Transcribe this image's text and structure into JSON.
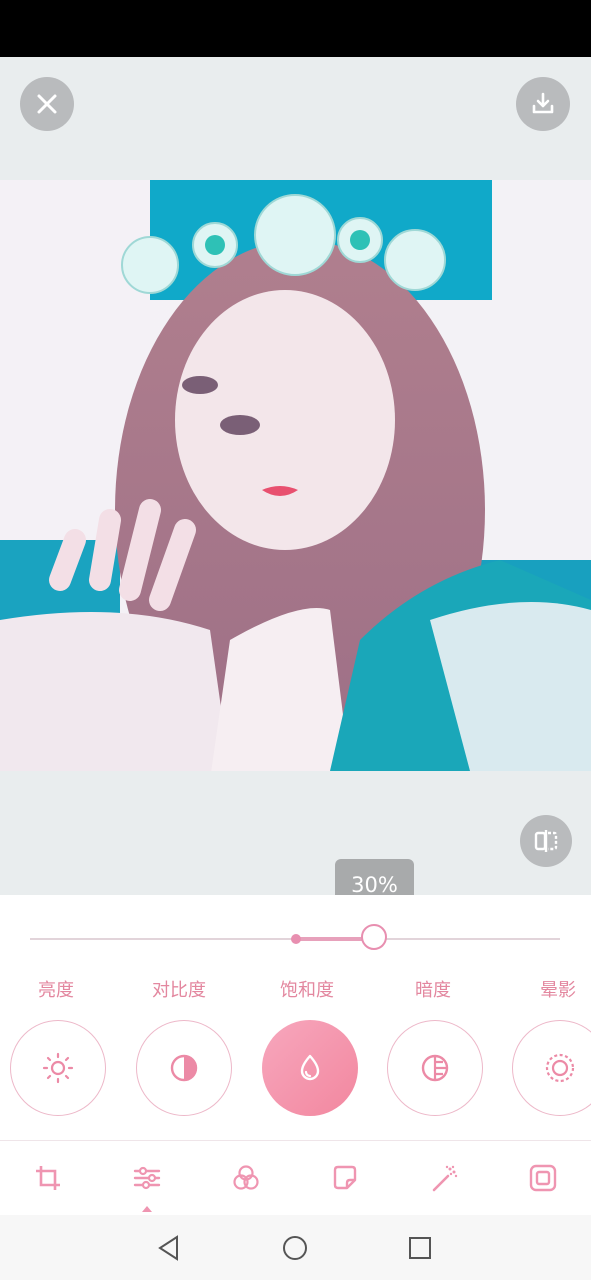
{
  "slider": {
    "value_label": "30%",
    "value": 0.3
  },
  "tools": [
    {
      "label": "亮度",
      "icon": "brightness-icon",
      "active": false
    },
    {
      "label": "对比度",
      "icon": "contrast-icon",
      "active": false
    },
    {
      "label": "饱和度",
      "icon": "saturation-drop-icon",
      "active": true
    },
    {
      "label": "暗度",
      "icon": "shadow-icon",
      "active": false
    },
    {
      "label": "晕影",
      "icon": "vignette-icon",
      "active": false
    }
  ],
  "bottom_tabs": [
    {
      "icon": "crop-icon",
      "active": false
    },
    {
      "icon": "adjust-sliders-icon",
      "active": true
    },
    {
      "icon": "filters-circles-icon",
      "active": false
    },
    {
      "icon": "sticker-icon",
      "active": false
    },
    {
      "icon": "magic-wand-icon",
      "active": false
    },
    {
      "icon": "frame-icon",
      "active": false
    }
  ],
  "colors": {
    "accent": "#f2879f",
    "label": "#e3879f",
    "toolbar_button": "#b9bbbd",
    "canvas_bg": "#e9edee"
  }
}
